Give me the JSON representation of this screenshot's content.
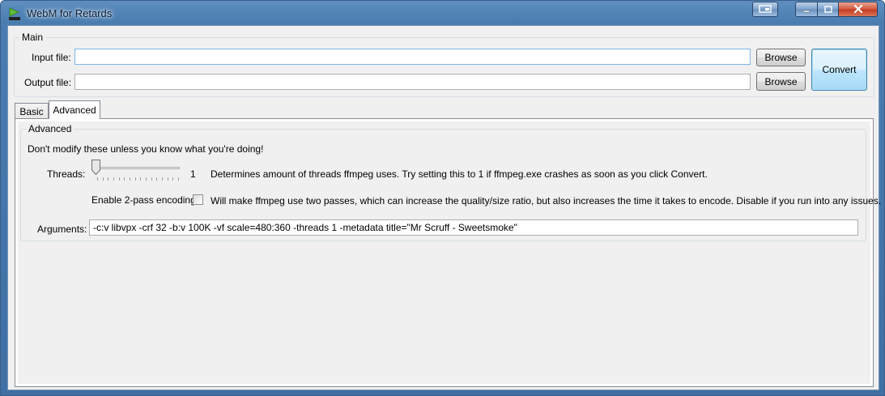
{
  "window": {
    "title": "WebM for Retards",
    "icon_text": "webm"
  },
  "caption_buttons": {
    "extra": "window-extra-icon",
    "minimize": "minimize-icon",
    "maximize": "maximize-icon",
    "close": "close-icon"
  },
  "main": {
    "group_label": "Main",
    "input_label": "Input file:",
    "input_value": "",
    "output_label": "Output file:",
    "output_value": "",
    "browse_label": "Browse",
    "convert_label": "Convert"
  },
  "tabs": [
    {
      "label": "Basic",
      "selected": false
    },
    {
      "label": "Advanced",
      "selected": true
    }
  ],
  "advanced": {
    "group_label": "Advanced",
    "warning": "Don't modify these unless you know what you're doing!",
    "threads_label": "Threads:",
    "threads_value": "1",
    "threads_slider_fraction": 0,
    "threads_help": "Determines amount of threads ffmpeg uses. Try setting this to 1 if ffmpeg.exe crashes as soon as you click Convert.",
    "twopass_label": "Enable 2-pass encoding:",
    "twopass_checked": false,
    "twopass_help": "Will make ffmpeg use two passes, which can increase the quality/size ratio, but also increases the time it takes to encode. Disable if you run into any issues.",
    "arguments_label": "Arguments:",
    "arguments_value": "-c:v libvpx -crf 32 -b:v 100K -vf scale=480:360  -threads 1  -metadata title=\"Mr Scruff - Sweetsmoke\""
  }
}
